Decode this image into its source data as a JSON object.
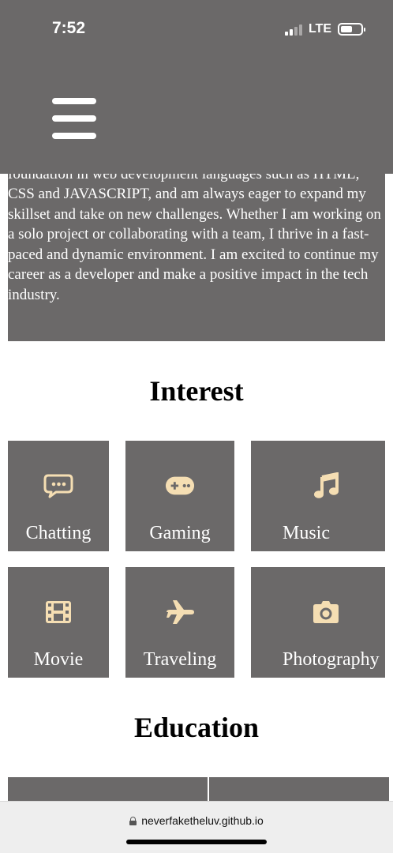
{
  "status_bar": {
    "time": "7:52",
    "network": "LTE"
  },
  "about": {
    "text": "foundation in web development languages such as HTML, CSS and JAVASCRIPT, and am always eager to expand my skillset and take on new challenges. Whether I am working on a solo project or collaborating with a team, I thrive in a fast-paced and dynamic environment. I am excited to continue my career as a developer and make a positive impact in the tech industry."
  },
  "interest": {
    "title": "Interest",
    "items": [
      {
        "label": "Chatting",
        "icon": "chat-bubble-icon"
      },
      {
        "label": "Gaming",
        "icon": "gamepad-icon"
      },
      {
        "label": "Music",
        "icon": "music-note-icon"
      },
      {
        "label": "Movie",
        "icon": "film-icon"
      },
      {
        "label": "Traveling",
        "icon": "plane-icon"
      },
      {
        "label": "Photography",
        "icon": "camera-icon"
      }
    ]
  },
  "education": {
    "title": "Education"
  },
  "browser": {
    "url": "neverfaketheluv.github.io"
  },
  "colors": {
    "panel": "#6b6969",
    "icon": "#f5deb3",
    "text": "#ffffff",
    "heading": "#000000"
  }
}
